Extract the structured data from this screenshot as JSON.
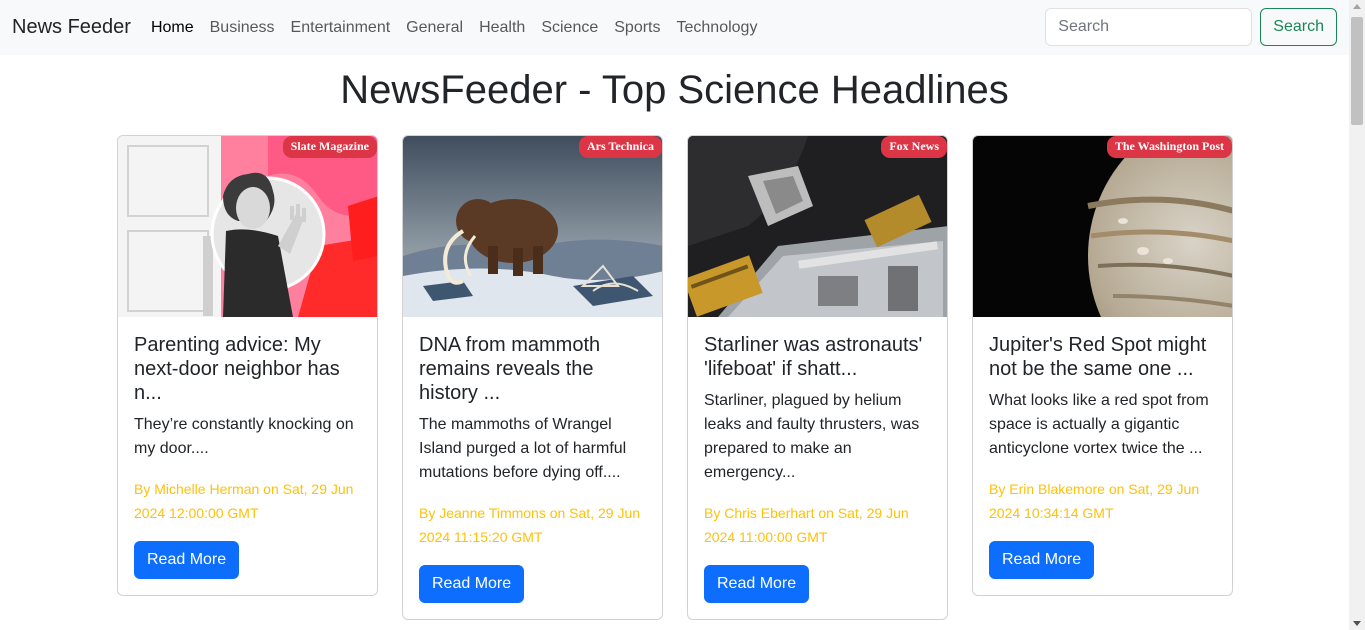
{
  "brand": "News Feeder",
  "nav": {
    "items": [
      {
        "label": "Home"
      },
      {
        "label": "Business"
      },
      {
        "label": "Entertainment"
      },
      {
        "label": "General"
      },
      {
        "label": "Health"
      },
      {
        "label": "Science"
      },
      {
        "label": "Sports"
      },
      {
        "label": "Technology"
      }
    ]
  },
  "search": {
    "placeholder": "Search",
    "button_label": "Search"
  },
  "page_title": "NewsFeeder - Top Science Headlines",
  "colors": {
    "badge": "#dc3545",
    "meta_text": "#ffc107",
    "primary_button": "#0d6efd",
    "search_button": "#198754"
  },
  "articles": [
    {
      "source": "Slate Magazine",
      "title": "Parenting advice: My next-door neighbor has n...",
      "description": "They’re constantly knocking on my door....",
      "meta": "By Michelle Herman on Sat, 29 Jun 2024 12:00:00 GMT",
      "button_label": "Read More",
      "image_icon": "child-waving-photo"
    },
    {
      "source": "Ars Technica",
      "title": "DNA from mammoth remains reveals the history ...",
      "description": "The mammoths of Wrangel Island purged a lot of harmful mutations before dying off....",
      "meta": "By Jeanne Timmons on Sat, 29 Jun 2024 11:15:20 GMT",
      "button_label": "Read More",
      "image_icon": "mammoth-illustration"
    },
    {
      "source": "Fox News",
      "title": "Starliner was astronauts' 'lifeboat' if shatt...",
      "description": "Starliner, plagued by helium leaks and faulty thrusters, was prepared to make an emergency...",
      "meta": "By Chris Eberhart on Sat, 29 Jun 2024 11:00:00 GMT",
      "button_label": "Read More",
      "image_icon": "space-station-photo"
    },
    {
      "source": "The Washington Post",
      "title": "Jupiter's Red Spot might not be the same one ...",
      "description": "What looks like a red spot from space is actually a gigantic anticyclone vortex twice the ...",
      "meta": "By Erin Blakemore on Sat, 29 Jun 2024 10:34:14 GMT",
      "button_label": "Read More",
      "image_icon": "jupiter-photo"
    }
  ]
}
